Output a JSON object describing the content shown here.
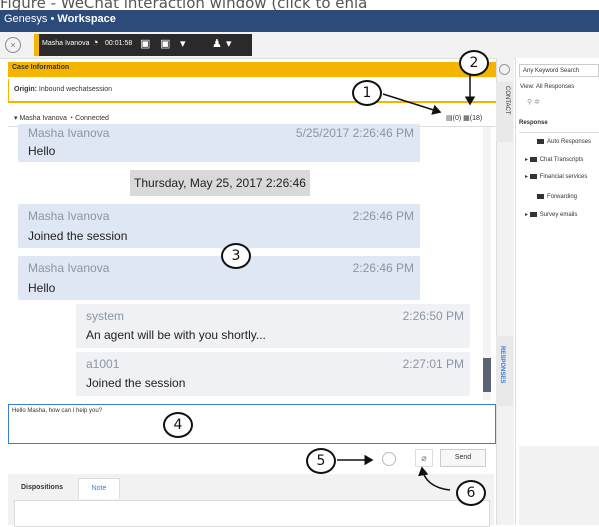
{
  "caption": "Figure - WeChat interaction window (click to enla",
  "app": {
    "logo_text": "Genesys",
    "separator": "•",
    "name": "Workspace"
  },
  "toolbar": {
    "contact_name": "Masha Ivanova",
    "timer": "00:01:58"
  },
  "case": {
    "title": "Case Information",
    "origin_label": "Origin:",
    "origin_value": "Inbound wechatsession"
  },
  "participant": {
    "name": "Masha Ivanova",
    "status": "Connected",
    "count_a": "(0)",
    "count_b": "(18)"
  },
  "transcript": {
    "top_msg": {
      "author": "Masha Ivanova",
      "time": "5/25/2017 2:26:46 PM",
      "text": "Hello"
    },
    "date_separator": "Thursday, May 25, 2017 2:26:46 PM",
    "messages": [
      {
        "author": "Masha Ivanova",
        "time": "2:26:46 PM",
        "text": "Joined the session"
      },
      {
        "author": "Masha Ivanova",
        "time": "2:26:46 PM",
        "text": "Hello"
      },
      {
        "author": "system",
        "time": "2:26:50 PM",
        "text": "An agent will be with you shortly..."
      },
      {
        "author": "a1001",
        "time": "2:27:01 PM",
        "text": "Joined the session"
      }
    ]
  },
  "composer": {
    "text": "Hello Masha, how can I help you?"
  },
  "actions": {
    "send_label": "Send"
  },
  "bottom_tabs": {
    "dispositions": "Dispositions",
    "note": "Note"
  },
  "side_tabs": {
    "contact": "CONTACT",
    "responses": "RESPONSES"
  },
  "right_panel": {
    "search_placeholder": "Any Keyword Search",
    "view_label": "View:",
    "view_value": "All Responses",
    "header": "Response",
    "items": [
      "Auto Responses",
      "Chat Transcripts",
      "Financial services",
      "Forwarding",
      "Survey emails"
    ]
  },
  "annotations": [
    "1",
    "2",
    "3",
    "4",
    "5",
    "6"
  ],
  "colors": {
    "accent": "#f5b400",
    "title_bar": "#2c4a7a",
    "bubble": "#dfe7f4",
    "link": "#3a7ed8"
  }
}
